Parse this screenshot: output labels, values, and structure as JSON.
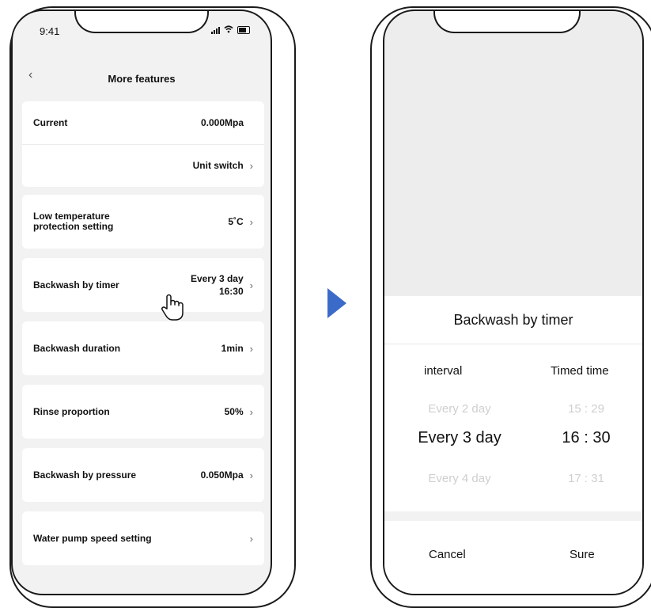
{
  "status_bar": {
    "time": "9:41"
  },
  "left": {
    "nav": {
      "back_icon": "‹",
      "title": "More features"
    },
    "rows": {
      "current": {
        "label": "Current",
        "value": "0.000Mpa"
      },
      "unit_switch": {
        "value": "Unit switch"
      },
      "low_temp": {
        "label_line1": "Low temperature",
        "label_line2": "protection setting",
        "value": "5˚C"
      },
      "backwash_timer": {
        "label": "Backwash by timer",
        "value_line1": "Every 3 day",
        "value_line2": "16:30"
      },
      "backwash_duration": {
        "label": "Backwash duration",
        "value": "1min"
      },
      "rinse": {
        "label": "Rinse proportion",
        "value": "50%"
      },
      "backwash_pressure": {
        "label": "Backwash by pressure",
        "value": "0.050Mpa"
      },
      "pump_speed": {
        "label": "Water pump speed setting"
      }
    },
    "chevron": "›"
  },
  "arrow_color": "#3b6bc9",
  "right": {
    "sheet_title": "Backwash by timer",
    "col_interval": "interval",
    "col_time": "Timed time",
    "interval_options": [
      "Every 2 day",
      "Every 3 day",
      "Every 4 day"
    ],
    "time_options": [
      "15 : 29",
      "16 : 30",
      "17 : 31"
    ],
    "cancel": "Cancel",
    "sure": "Sure"
  }
}
